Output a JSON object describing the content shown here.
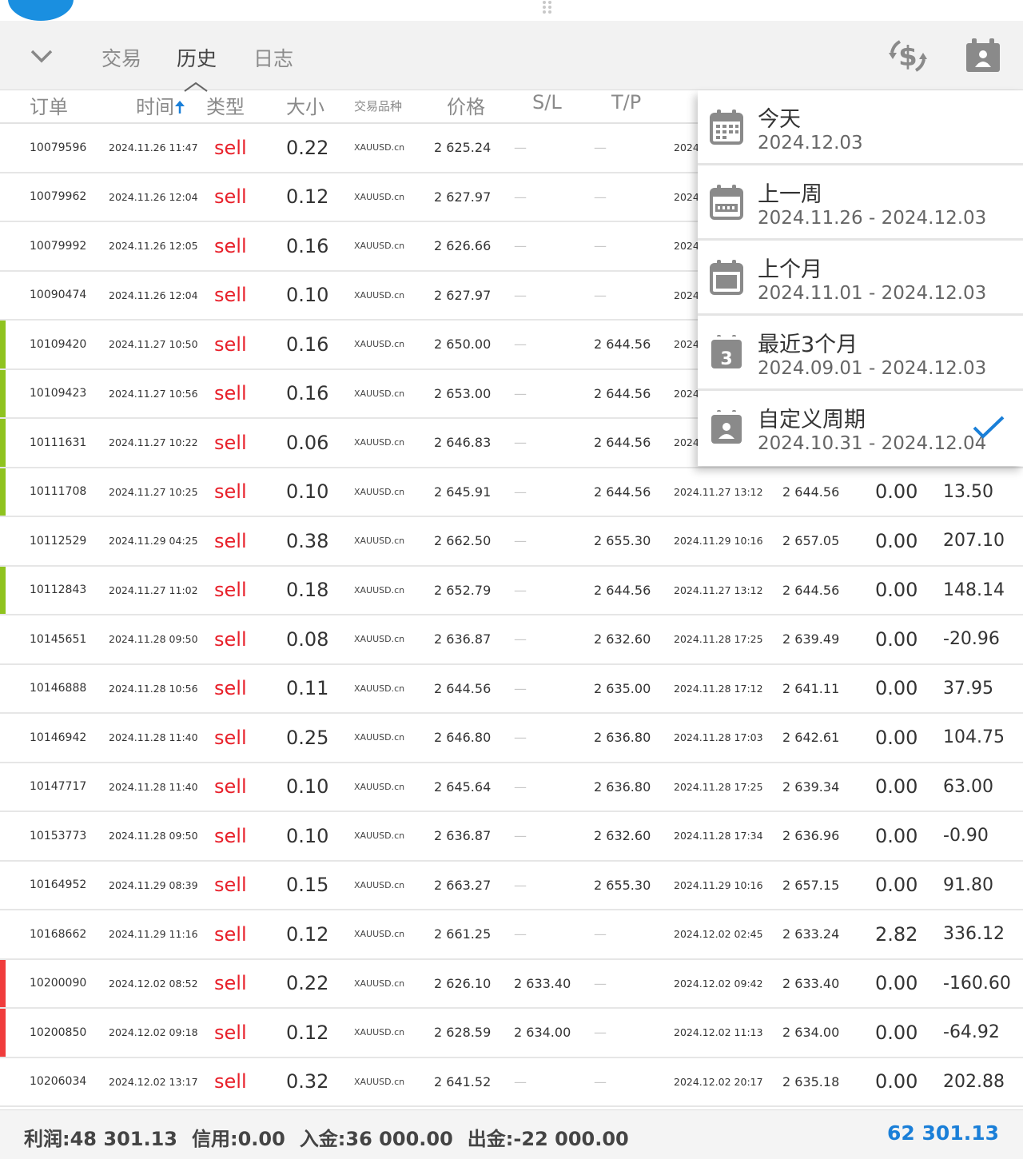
{
  "tabs": [
    {
      "label": "交易",
      "active": false
    },
    {
      "label": "历史",
      "active": true
    },
    {
      "label": "日志",
      "active": false
    }
  ],
  "columns": {
    "order": "订单",
    "time": "时间",
    "type": "类型",
    "size": "大小",
    "symbol": "交易品种",
    "price": "价格",
    "sl": "S/L",
    "tp": "T/P"
  },
  "rows": [
    {
      "order": "10079596",
      "time": "2024.11.26 11:47",
      "type": "sell",
      "size": "0.22",
      "symbol": "XAUUSD.cn",
      "price": "2 625.24",
      "sl": "—",
      "tp": "—",
      "close_time": "2024",
      "close_price": "",
      "swap": "",
      "profit": "",
      "bar": ""
    },
    {
      "order": "10079962",
      "time": "2024.11.26 12:04",
      "type": "sell",
      "size": "0.12",
      "symbol": "XAUUSD.cn",
      "price": "2 627.97",
      "sl": "—",
      "tp": "—",
      "close_time": "2024",
      "close_price": "",
      "swap": "",
      "profit": "",
      "bar": ""
    },
    {
      "order": "10079992",
      "time": "2024.11.26 12:05",
      "type": "sell",
      "size": "0.16",
      "symbol": "XAUUSD.cn",
      "price": "2 626.66",
      "sl": "—",
      "tp": "—",
      "close_time": "2024",
      "close_price": "",
      "swap": "",
      "profit": "",
      "bar": ""
    },
    {
      "order": "10090474",
      "time": "2024.11.26 12:04",
      "type": "sell",
      "size": "0.10",
      "symbol": "XAUUSD.cn",
      "price": "2 627.97",
      "sl": "—",
      "tp": "—",
      "close_time": "2024",
      "close_price": "",
      "swap": "",
      "profit": "",
      "bar": ""
    },
    {
      "order": "10109420",
      "time": "2024.11.27 10:50",
      "type": "sell",
      "size": "0.16",
      "symbol": "XAUUSD.cn",
      "price": "2 650.00",
      "sl": "—",
      "tp": "2 644.56",
      "close_time": "2024",
      "close_price": "",
      "swap": "",
      "profit": "",
      "bar": "#8fc31f"
    },
    {
      "order": "10109423",
      "time": "2024.11.27 10:56",
      "type": "sell",
      "size": "0.16",
      "symbol": "XAUUSD.cn",
      "price": "2 653.00",
      "sl": "—",
      "tp": "2 644.56",
      "close_time": "2024",
      "close_price": "",
      "swap": "",
      "profit": "",
      "bar": "#8fc31f"
    },
    {
      "order": "10111631",
      "time": "2024.11.27 10:22",
      "type": "sell",
      "size": "0.06",
      "symbol": "XAUUSD.cn",
      "price": "2 646.83",
      "sl": "—",
      "tp": "2 644.56",
      "close_time": "2024",
      "close_price": "",
      "swap": "",
      "profit": "",
      "bar": "#8fc31f"
    },
    {
      "order": "10111708",
      "time": "2024.11.27 10:25",
      "type": "sell",
      "size": "0.10",
      "symbol": "XAUUSD.cn",
      "price": "2 645.91",
      "sl": "—",
      "tp": "2 644.56",
      "close_time": "2024.11.27 13:12",
      "close_price": "2 644.56",
      "swap": "0.00",
      "profit": "13.50",
      "bar": "#8fc31f"
    },
    {
      "order": "10112529",
      "time": "2024.11.29 04:25",
      "type": "sell",
      "size": "0.38",
      "symbol": "XAUUSD.cn",
      "price": "2 662.50",
      "sl": "—",
      "tp": "2 655.30",
      "close_time": "2024.11.29 10:16",
      "close_price": "2 657.05",
      "swap": "0.00",
      "profit": "207.10",
      "bar": ""
    },
    {
      "order": "10112843",
      "time": "2024.11.27 11:02",
      "type": "sell",
      "size": "0.18",
      "symbol": "XAUUSD.cn",
      "price": "2 652.79",
      "sl": "—",
      "tp": "2 644.56",
      "close_time": "2024.11.27 13:12",
      "close_price": "2 644.56",
      "swap": "0.00",
      "profit": "148.14",
      "bar": "#8fc31f"
    },
    {
      "order": "10145651",
      "time": "2024.11.28 09:50",
      "type": "sell",
      "size": "0.08",
      "symbol": "XAUUSD.cn",
      "price": "2 636.87",
      "sl": "—",
      "tp": "2 632.60",
      "close_time": "2024.11.28 17:25",
      "close_price": "2 639.49",
      "swap": "0.00",
      "profit": "-20.96",
      "bar": ""
    },
    {
      "order": "10146888",
      "time": "2024.11.28 10:56",
      "type": "sell",
      "size": "0.11",
      "symbol": "XAUUSD.cn",
      "price": "2 644.56",
      "sl": "—",
      "tp": "2 635.00",
      "close_time": "2024.11.28 17:12",
      "close_price": "2 641.11",
      "swap": "0.00",
      "profit": "37.95",
      "bar": ""
    },
    {
      "order": "10146942",
      "time": "2024.11.28 11:40",
      "type": "sell",
      "size": "0.25",
      "symbol": "XAUUSD.cn",
      "price": "2 646.80",
      "sl": "—",
      "tp": "2 636.80",
      "close_time": "2024.11.28 17:03",
      "close_price": "2 642.61",
      "swap": "0.00",
      "profit": "104.75",
      "bar": ""
    },
    {
      "order": "10147717",
      "time": "2024.11.28 11:40",
      "type": "sell",
      "size": "0.10",
      "symbol": "XAUUSD.cn",
      "price": "2 645.64",
      "sl": "—",
      "tp": "2 636.80",
      "close_time": "2024.11.28 17:25",
      "close_price": "2 639.34",
      "swap": "0.00",
      "profit": "63.00",
      "bar": ""
    },
    {
      "order": "10153773",
      "time": "2024.11.28 09:50",
      "type": "sell",
      "size": "0.10",
      "symbol": "XAUUSD.cn",
      "price": "2 636.87",
      "sl": "—",
      "tp": "2 632.60",
      "close_time": "2024.11.28 17:34",
      "close_price": "2 636.96",
      "swap": "0.00",
      "profit": "-0.90",
      "bar": ""
    },
    {
      "order": "10164952",
      "time": "2024.11.29 08:39",
      "type": "sell",
      "size": "0.15",
      "symbol": "XAUUSD.cn",
      "price": "2 663.27",
      "sl": "—",
      "tp": "2 655.30",
      "close_time": "2024.11.29 10:16",
      "close_price": "2 657.15",
      "swap": "0.00",
      "profit": "91.80",
      "bar": ""
    },
    {
      "order": "10168662",
      "time": "2024.11.29 11:16",
      "type": "sell",
      "size": "0.12",
      "symbol": "XAUUSD.cn",
      "price": "2 661.25",
      "sl": "—",
      "tp": "—",
      "close_time": "2024.12.02 02:45",
      "close_price": "2 633.24",
      "swap": "2.82",
      "profit": "336.12",
      "bar": ""
    },
    {
      "order": "10200090",
      "time": "2024.12.02 08:52",
      "type": "sell",
      "size": "0.22",
      "symbol": "XAUUSD.cn",
      "price": "2 626.10",
      "sl": "2 633.40",
      "tp": "—",
      "close_time": "2024.12.02 09:42",
      "close_price": "2 633.40",
      "swap": "0.00",
      "profit": "-160.60",
      "bar": "#f03c3c"
    },
    {
      "order": "10200850",
      "time": "2024.12.02 09:18",
      "type": "sell",
      "size": "0.12",
      "symbol": "XAUUSD.cn",
      "price": "2 628.59",
      "sl": "2 634.00",
      "tp": "—",
      "close_time": "2024.12.02 11:13",
      "close_price": "2 634.00",
      "swap": "0.00",
      "profit": "-64.92",
      "bar": "#f03c3c"
    },
    {
      "order": "10206034",
      "time": "2024.12.02 13:17",
      "type": "sell",
      "size": "0.32",
      "symbol": "XAUUSD.cn",
      "price": "2 641.52",
      "sl": "—",
      "tp": "—",
      "close_time": "2024.12.02 20:17",
      "close_price": "2 635.18",
      "swap": "0.00",
      "profit": "202.88",
      "bar": ""
    }
  ],
  "footer": {
    "profit_label": "利润:",
    "profit_value": "48 301.13",
    "credit_label": "信用:",
    "credit_value": "0.00",
    "deposit_label": "入金:",
    "deposit_value": "36 000.00",
    "withdraw_label": "出金:",
    "withdraw_value": "-22 000.00",
    "balance": "62 301.13"
  },
  "period_menu": [
    {
      "title": "今天",
      "range": "2024.12.03",
      "icon": "calendar-today-icon",
      "selected": false
    },
    {
      "title": "上一周",
      "range": "2024.11.26 - 2024.12.03",
      "icon": "calendar-week-icon",
      "selected": false
    },
    {
      "title": "上个月",
      "range": "2024.11.01 - 2024.12.03",
      "icon": "calendar-month-icon",
      "selected": false
    },
    {
      "title": "最近3个月",
      "range": "2024.09.01 - 2024.12.03",
      "icon": "calendar-3-months-icon",
      "badge": "3",
      "selected": false
    },
    {
      "title": "自定义周期",
      "range": "2024.10.31 - 2024.12.04",
      "icon": "calendar-custom-icon",
      "selected": true
    }
  ],
  "colors": {
    "sell": "#e8202a",
    "accent": "#1a7fd8",
    "tp_bar": "#8fc31f",
    "sl_bar": "#f03c3c"
  }
}
